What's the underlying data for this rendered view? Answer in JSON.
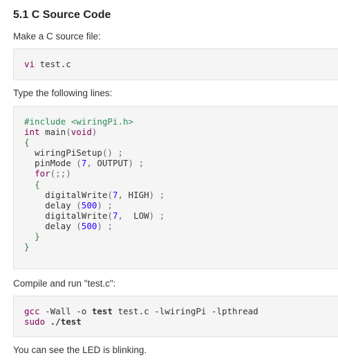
{
  "heading": "5.1 C Source Code",
  "step1_text": "Make a C source file:",
  "step1_code": "vi test.c",
  "step2_text": "Type the following lines:",
  "code_lines": [
    "#include <wiringPi.h>",
    "int main(void)",
    "{",
    "  wiringPiSetup() ;",
    "  pinMode (7, OUTPUT) ;",
    "  for(;;)",
    "  {",
    "    digitalWrite(7, HIGH) ;",
    "    delay (500) ;",
    "    digitalWrite(7,  LOW) ;",
    "    delay (500) ;",
    "  }",
    "}"
  ],
  "step3_text": "Compile and run \"test.c\":",
  "compile_lines": [
    "gcc -Wall -o test test.c -lwiringPi -lpthread",
    "sudo ./test"
  ],
  "final_text": "You can see the LED is blinking."
}
